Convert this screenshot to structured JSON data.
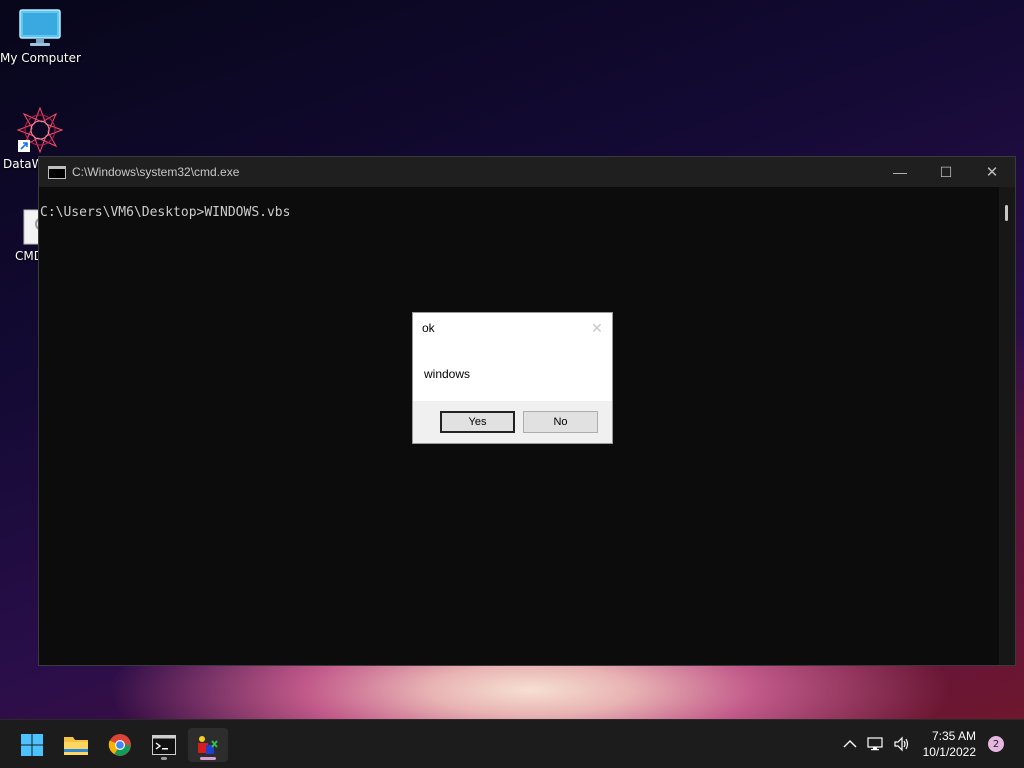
{
  "desktop": {
    "icons": [
      {
        "label": "My Computer",
        "icon": "monitor-icon"
      },
      {
        "label": "DataW",
        "icon": "datawave-icon"
      },
      {
        "label": "CMD",
        "icon": "script-file-icon"
      }
    ]
  },
  "cmd_window": {
    "title": "C:\\Windows\\system32\\cmd.exe",
    "buttons": {
      "minimize": "—",
      "maximize": "☐",
      "close": "✕"
    },
    "lines": [
      "C:\\Users\\VM6\\Desktop>WINDOWS.vbs"
    ]
  },
  "message_box": {
    "title": "ok",
    "message": "windows",
    "close_glyph": "✕",
    "buttons": {
      "yes": "Yes",
      "no": "No"
    }
  },
  "taskbar": {
    "items": [
      "windows-start-icon",
      "file-explorer-icon",
      "chrome-icon",
      "terminal-icon",
      "vbs-script-app-icon"
    ],
    "tray": {
      "time": "7:35 AM",
      "date": "10/1/2022",
      "notification_count": "2"
    }
  },
  "colors": {
    "accent_indicator": "#d79ed0",
    "terminal_bg": "#0c0c0c"
  }
}
